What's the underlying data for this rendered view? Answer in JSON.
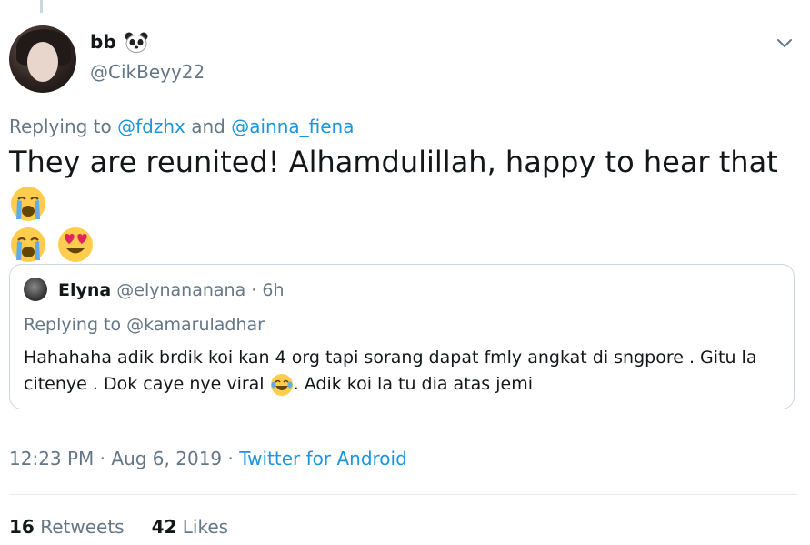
{
  "user": {
    "display_name": "bb",
    "handle": "@CikBeyy22"
  },
  "replying": {
    "prefix": "Replying to",
    "user1": "@fdzhx",
    "conj": "and",
    "user2": "@ainna_fiena"
  },
  "tweet": {
    "text": "They are reunited! Alhamdulillah, happy to hear that",
    "emojis": [
      "loudly-crying-face-emoji",
      "loudly-crying-face-emoji",
      "heart-eyes-emoji"
    ]
  },
  "quote": {
    "name": "Elyna",
    "handle": "@elynananana",
    "sep": "·",
    "time": "6h",
    "replying_prefix": "Replying to",
    "replying_user": "@kamaruladhar",
    "text_part1": "Hahahaha adik brdik koi kan 4 org tapi sorang dapat fmly angkat di sngpore . Gitu la citenye . Dok caye nye viral",
    "text_part2": ". Adik koi la tu dia atas jemi",
    "emoji": "tears-of-joy-emoji"
  },
  "meta": {
    "time": "12:23 PM",
    "sep": "·",
    "date": "Aug 6, 2019",
    "sep2": "·",
    "source": "Twitter for Android"
  },
  "stats": {
    "retweets_count": "16",
    "retweets_label": "Retweets",
    "likes_count": "42",
    "likes_label": "Likes"
  },
  "colors": {
    "link": "#1b95e0",
    "muted": "#657786",
    "text": "#14171a",
    "border": "#ccd6dd"
  }
}
